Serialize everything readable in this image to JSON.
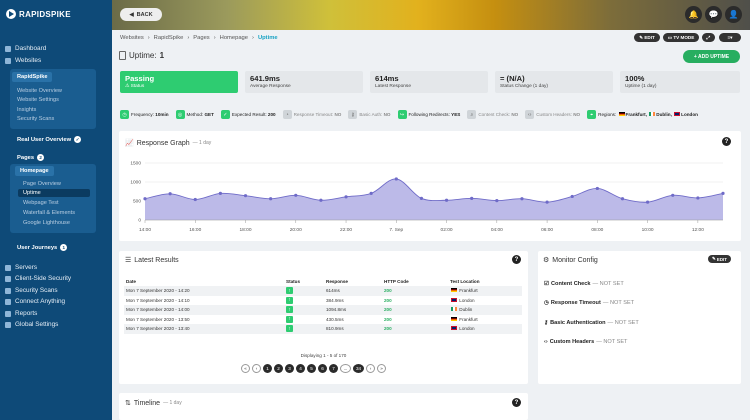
{
  "app": {
    "brand": "RAPIDSPIKE"
  },
  "sidebar": {
    "dashboard": "Dashboard",
    "websites": "Websites",
    "site_pill": "RapidSpike",
    "site_links": [
      "Website Overview",
      "Website Settings",
      "Insights",
      "Security Scans"
    ],
    "rum": "Real User Overview",
    "pages_label": "Pages",
    "pages_count": "2",
    "page_pill": "Homepage",
    "page_links": [
      "Page Overview",
      "Uptime",
      "Webpage Test",
      "Waterfall & Elements",
      "Google Lighthouse"
    ],
    "journeys_label": "User Journeys",
    "journeys_count": "1",
    "bottom": [
      "Servers",
      "Client-Side Security",
      "Security Scans",
      "Connect Anything",
      "Reports",
      "Global Settings"
    ]
  },
  "topbar": {
    "back": "BACK",
    "icons": [
      "bell-icon",
      "chat-icon",
      "user-icon"
    ]
  },
  "breadcrumb": [
    "Websites",
    "RapidSpike",
    "Pages",
    "Homepage",
    "Uptime"
  ],
  "header_buttons": {
    "edit": "EDIT",
    "tvmode": "TV MODE"
  },
  "title": {
    "label": "Uptime:",
    "count": "1"
  },
  "add_uptime": "+ ADD UPTIME",
  "stats": [
    {
      "value": "Passing",
      "label": "⚠ Status"
    },
    {
      "value": "641.9ms",
      "label": "Average Response"
    },
    {
      "value": "614ms",
      "label": "Latest Response"
    },
    {
      "value": "= (N/A)",
      "label": "Status Change (1 day)"
    },
    {
      "value": "100%",
      "label": "Uptime (1 day)"
    }
  ],
  "tags": [
    {
      "label": "Frequency:",
      "value": "10min",
      "on": true
    },
    {
      "label": "Method:",
      "value": "GET",
      "on": true
    },
    {
      "label": "Expected Result:",
      "value": "200",
      "on": true
    },
    {
      "label": "Response Timeout:",
      "value": "NO",
      "on": false
    },
    {
      "label": "Basic Auth:",
      "value": "NO",
      "on": false
    },
    {
      "label": "Following Redirects:",
      "value": "YES",
      "on": true
    },
    {
      "label": "Content Check:",
      "value": "NO",
      "on": false
    },
    {
      "label": "Custom Headers:",
      "value": "NO",
      "on": false
    },
    {
      "label": "Regions:",
      "value": "",
      "on": true
    }
  ],
  "regions": [
    "Frankfurt,",
    "Dublin,",
    "London"
  ],
  "graph": {
    "title": "Response Graph",
    "sub": "— 1 day"
  },
  "chart_data": {
    "type": "area",
    "x": [
      "14:00",
      "15:00",
      "16:00",
      "17:00",
      "18:00",
      "19:00",
      "20:00",
      "21:00",
      "22:00",
      "23:00",
      "7. Sep",
      "01:00",
      "02:00",
      "03:00",
      "04:00",
      "05:00",
      "06:00",
      "07:00",
      "08:00",
      "09:00",
      "10:00",
      "11:00",
      "12:00",
      "13:00"
    ],
    "x_ticks": [
      "14:00",
      "16:00",
      "18:00",
      "20:00",
      "22:00",
      "7. Sep",
      "02:00",
      "04:00",
      "06:00",
      "08:00",
      "10:00",
      "12:00"
    ],
    "values": [
      560,
      690,
      540,
      700,
      640,
      560,
      650,
      520,
      610,
      700,
      1080,
      570,
      520,
      570,
      510,
      560,
      470,
      620,
      830,
      560,
      470,
      650,
      580,
      700
    ],
    "ylim": [
      0,
      1500
    ],
    "y_ticks": [
      0,
      500,
      1000,
      1500
    ],
    "color": "#b5b3e6",
    "line_color": "#6f6bc8"
  },
  "latest": {
    "title": "Latest Results",
    "columns": [
      "Date",
      "Status",
      "Response",
      "HTTP Code",
      "Test Location"
    ],
    "rows": [
      {
        "date": "Mon 7 September 2020 - 14:20",
        "resp": "614ms",
        "code": "200",
        "loc": "Frankfurt",
        "flag": "de"
      },
      {
        "date": "Mon 7 September 2020 - 14:10",
        "resp": "384.9ms",
        "code": "200",
        "loc": "London",
        "flag": "gb"
      },
      {
        "date": "Mon 7 September 2020 - 14:00",
        "resp": "1094.8ms",
        "code": "200",
        "loc": "Dublin",
        "flag": "ie"
      },
      {
        "date": "Mon 7 September 2020 - 13:50",
        "resp": "430.5ms",
        "code": "200",
        "loc": "Frankfurt",
        "flag": "de"
      },
      {
        "date": "Mon 7 September 2020 - 13:40",
        "resp": "810.9ms",
        "code": "200",
        "loc": "London",
        "flag": "gb"
      }
    ],
    "displaying": "Displaying 1 - 5 of 170",
    "pages": [
      "«",
      "‹",
      "1",
      "2",
      "3",
      "4",
      "5",
      "6",
      "7",
      "...",
      "34",
      "›",
      "»"
    ]
  },
  "monitor": {
    "title": "Monitor Config",
    "edit": "EDIT",
    "rows": [
      {
        "label": "Content Check",
        "value": "— NOT SET"
      },
      {
        "label": "Response Timeout",
        "value": "— NOT SET"
      },
      {
        "label": "Basic Authentication",
        "value": "— NOT SET"
      },
      {
        "label": "Custom Headers",
        "value": "— NOT SET"
      }
    ]
  },
  "timeline": {
    "title": "Timeline",
    "sub": "— 1 day"
  }
}
